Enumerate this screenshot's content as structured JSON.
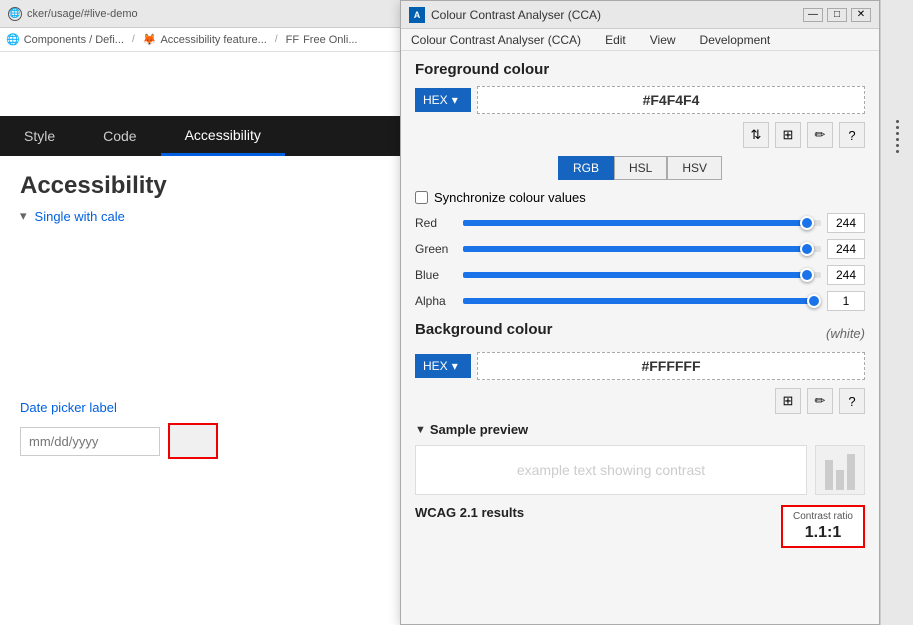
{
  "browser": {
    "tab_url": "cker/usage/#live-demo",
    "breadcrumbs": [
      {
        "label": "Components / Defi...",
        "icon": "globe"
      },
      {
        "label": "Accessibility feature...",
        "icon": "firefox"
      },
      {
        "label": "Free Onli...",
        "icon": "ff-logo"
      }
    ]
  },
  "webpage": {
    "nav_tabs": [
      {
        "label": "Style",
        "active": false
      },
      {
        "label": "Code",
        "active": false
      },
      {
        "label": "Accessibility",
        "active": true
      }
    ],
    "accessibility_heading": "Accessibility",
    "dropdown_label": "Single with cale",
    "datepicker_label": "Date picker label",
    "datepicker_placeholder": "mm/dd/yyyy"
  },
  "cca": {
    "title": "Colour Contrast Analyser (CCA)",
    "menu_items": [
      "Colour Contrast Analyser (CCA)",
      "Edit",
      "View",
      "Development"
    ],
    "foreground_section": "Foreground colour",
    "hex_label": "HEX",
    "fg_hex_value": "#F4F4F4",
    "bg_hex_value": "#FFFFFF",
    "color_tabs": [
      "RGB",
      "HSL",
      "HSV"
    ],
    "active_color_tab": "RGB",
    "sync_label": "Synchronize colour values",
    "sliders": [
      {
        "label": "Red",
        "value": 244,
        "percent": 96
      },
      {
        "label": "Green",
        "value": 244,
        "percent": 96
      },
      {
        "label": "Blue",
        "value": 244,
        "percent": 96
      },
      {
        "label": "Alpha",
        "value": 1,
        "percent": 99
      }
    ],
    "background_section": "Background colour",
    "bg_white_label": "(white)",
    "sample_section": "Sample preview",
    "sample_text": "example text showing contrast",
    "wcag_section": "WCAG 2.1 results",
    "contrast_ratio_label": "Contrast ratio",
    "contrast_ratio_value": "1.1:1"
  }
}
